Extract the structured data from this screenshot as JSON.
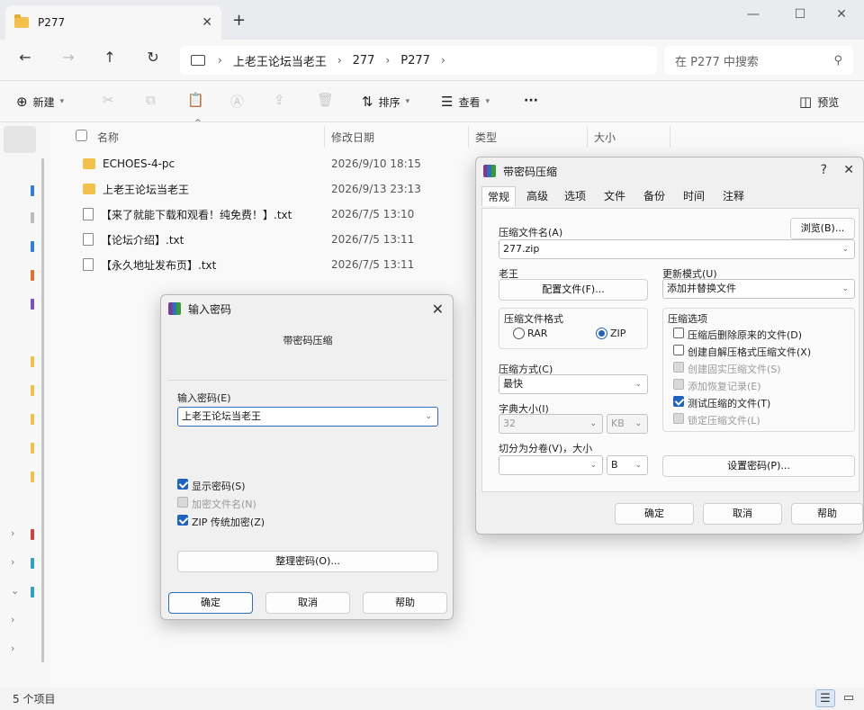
{
  "explorer": {
    "tab_title": "P277",
    "breadcrumb": [
      "上老王论坛当老王",
      "277",
      "P277"
    ],
    "search_placeholder": "在 P277 中搜索",
    "cmd": {
      "new": "新建",
      "sort": "排序",
      "view": "查看",
      "more": "···",
      "preview": "预览"
    },
    "columns": {
      "name": "名称",
      "modified": "修改日期",
      "type": "类型",
      "size": "大小"
    },
    "files": [
      {
        "name": "ECHOES-4-pc",
        "date": "2026/9/10 18:15",
        "kind": "folder"
      },
      {
        "name": "上老王论坛当老王",
        "date": "2026/9/13 23:13",
        "kind": "folder"
      },
      {
        "name": "【来了就能下载和观看！纯免费！】.txt",
        "date": "2026/7/5 13:10",
        "kind": "txt"
      },
      {
        "name": "【论坛介绍】.txt",
        "date": "2026/7/5 13:11",
        "kind": "txt"
      },
      {
        "name": "【永久地址发布页】.txt",
        "date": "2026/7/5 13:11",
        "kind": "txt"
      }
    ],
    "status": "5 个项目"
  },
  "archive_dialog": {
    "title": "带密码压缩",
    "help_mark": "?",
    "tabs": [
      "常规",
      "高级",
      "选项",
      "文件",
      "备份",
      "时间",
      "注释"
    ],
    "archive_name_label": "压缩文件名(A)",
    "browse": "浏览(B)...",
    "archive_name": "277.zip",
    "profile_label": "老王",
    "profile_button": "配置文件(F)...",
    "update_mode_label": "更新模式(U)",
    "update_mode": "添加并替换文件",
    "format_label": "压缩文件格式",
    "format_rar": "RAR",
    "format_zip": "ZIP",
    "options_label": "压缩选项",
    "options": [
      {
        "label": "压缩后删除原来的文件(D)",
        "checked": false,
        "enabled": true
      },
      {
        "label": "创建自解压格式压缩文件(X)",
        "checked": false,
        "enabled": true
      },
      {
        "label": "创建固实压缩文件(S)",
        "checked": false,
        "enabled": false
      },
      {
        "label": "添加恢复记录(E)",
        "checked": false,
        "enabled": false
      },
      {
        "label": "测试压缩的文件(T)",
        "checked": true,
        "enabled": true
      },
      {
        "label": "锁定压缩文件(L)",
        "checked": false,
        "enabled": false
      }
    ],
    "method_label": "压缩方式(C)",
    "method": "最快",
    "dict_label": "字典大小(I)",
    "dict_value": "32",
    "dict_unit": "KB",
    "split_label": "切分为分卷(V)，大小",
    "split_value": "",
    "split_unit": "B",
    "set_password": "设置密码(P)...",
    "ok": "确定",
    "cancel": "取消",
    "help": "帮助"
  },
  "password_dialog": {
    "title": "输入密码",
    "subtitle": "带密码压缩",
    "password_label": "输入密码(E)",
    "password_value": "上老王论坛当老王",
    "show_password": "显示密码(S)",
    "encrypt_names": "加密文件名(N)",
    "zip_legacy": "ZIP 传统加密(Z)",
    "organize": "整理密码(O)...",
    "ok": "确定",
    "cancel": "取消",
    "help": "帮助"
  }
}
